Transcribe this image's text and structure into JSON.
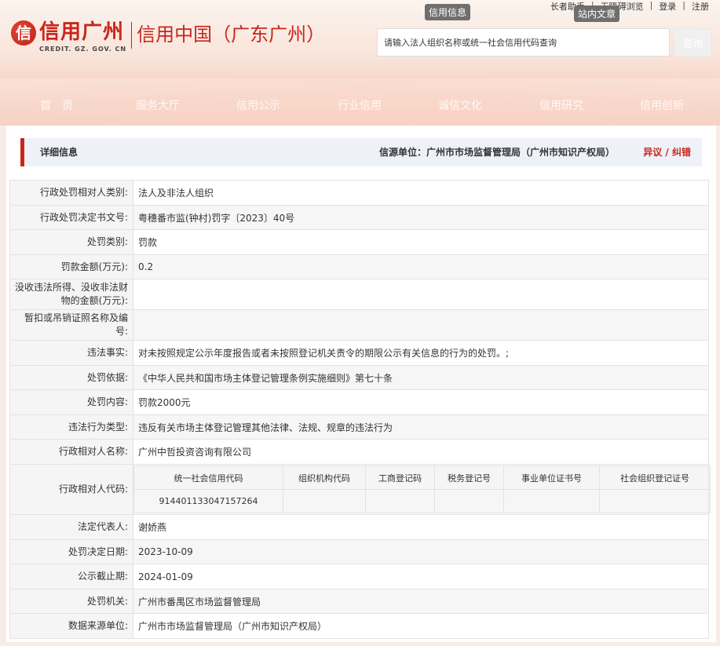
{
  "header": {
    "logo_mark": "信",
    "logo_cn": "信用广州",
    "logo_en": "CREDIT. GZ. GOV. CN",
    "logo_sub": "信用中国（广东广州）",
    "top_links": [
      "长者助手",
      "无障碍浏览",
      "登录",
      "注册"
    ],
    "tag_credit_info": "信用信息",
    "tag_site_search": "站内文章",
    "search_placeholder": "请输入法人组织名称或统一社会信用代码查询",
    "search_button": "查询",
    "nav": [
      "首　页",
      "服务大厅",
      "信用公示",
      "行业信用",
      "诚信文化",
      "信用研究",
      "信用创新"
    ]
  },
  "detail": {
    "title": "详细信息",
    "source": "信源单位：广州市市场监督管理局（广州市知识产权局）",
    "dispute": "异议 / 纠错"
  },
  "rows": [
    {
      "label": "行政处罚相对人类别:",
      "value": "法人及非法人组织"
    },
    {
      "label": "行政处罚决定书文号:",
      "value": "粤穗番市监(钟村)罚字〔2023〕40号"
    },
    {
      "label": "处罚类别:",
      "value": "罚款"
    },
    {
      "label": "罚款金额(万元):",
      "value": "0.2"
    },
    {
      "label": "没收违法所得、没收非法财物的金额(万元):",
      "value": ""
    },
    {
      "label": "暂扣或吊销证照名称及编号:",
      "value": ""
    },
    {
      "label": "违法事实:",
      "value": "对未按照规定公示年度报告或者未按照登记机关责令的期限公示有关信息的行为的处罚。;"
    },
    {
      "label": "处罚依据:",
      "value": "《中华人民共和国市场主体登记管理条例实施细则》第七十条"
    },
    {
      "label": "处罚内容:",
      "value": "罚款2000元"
    },
    {
      "label": "违法行为类型:",
      "value": "违反有关市场主体登记管理其他法律、法规、规章的违法行为"
    },
    {
      "label": "行政相对人名称:",
      "value": "广州中哲投资咨询有限公司"
    }
  ],
  "codes": {
    "label": "行政相对人代码:",
    "headers": [
      "统一社会信用代码",
      "组织机构代码",
      "工商登记码",
      "税务登记号",
      "事业单位证书号",
      "社会组织登记证号"
    ],
    "values": [
      "914401133047157264",
      "",
      "",
      "",
      "",
      ""
    ]
  },
  "rows2": [
    {
      "label": "法定代表人:",
      "value": "谢娇燕"
    },
    {
      "label": "处罚决定日期:",
      "value": "2023-10-09"
    },
    {
      "label": "公示截止期:",
      "value": "2024-01-09"
    },
    {
      "label": "处罚机关:",
      "value": "广州市番禺区市场监督管理局"
    },
    {
      "label": "数据来源单位:",
      "value": "广州市市场监督管理局（广州市知识产权局）"
    }
  ],
  "colors": {
    "accent": "#c8261b",
    "detail_bar": "#eef2f8"
  }
}
